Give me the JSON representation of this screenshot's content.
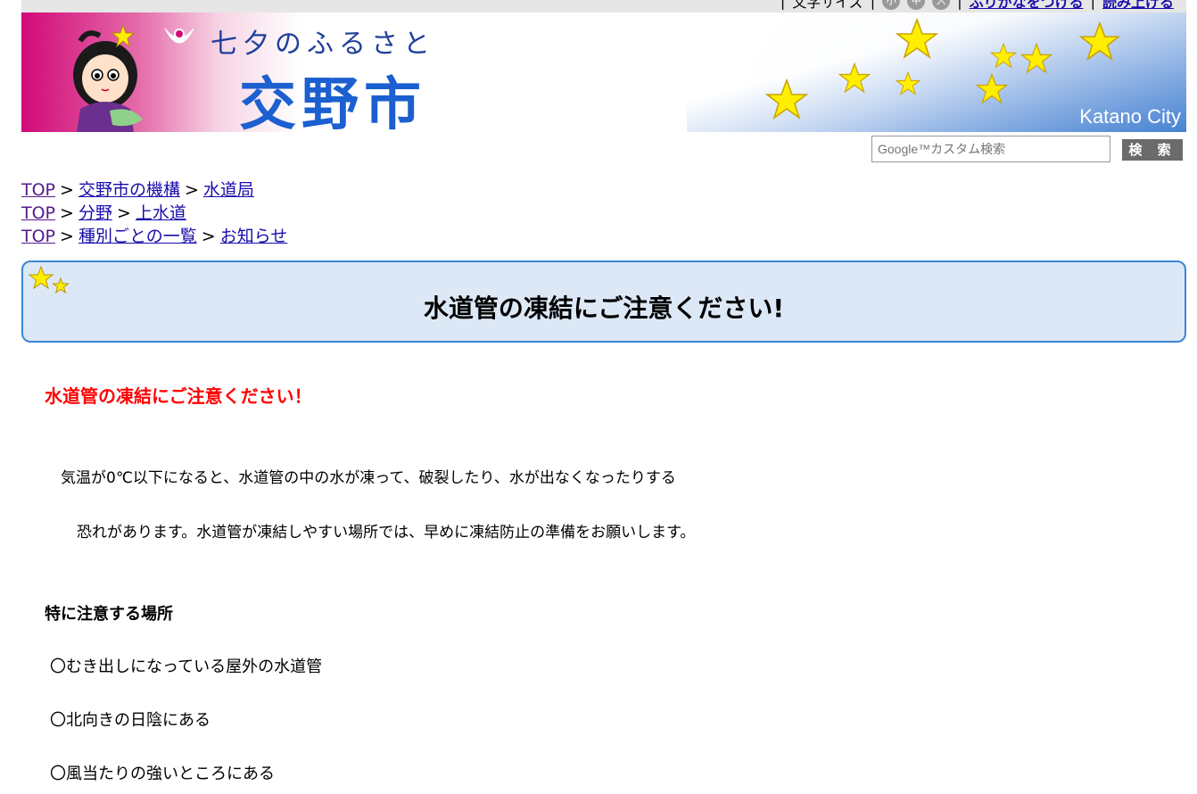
{
  "topbar": {
    "text_fragment": "文字サイズ",
    "sizes": [
      "小",
      "中",
      "大"
    ],
    "link1": "ふりがなをつける",
    "link2": "読み上げる"
  },
  "header": {
    "tagline": "七夕のふるさと",
    "city_name": "交野市",
    "city_name_en": "Katano City"
  },
  "search": {
    "placeholder": "Google™カスタム検索",
    "button_label": "検 索"
  },
  "breadcrumbs": [
    [
      "TOP",
      "交野市の機構",
      "水道局"
    ],
    [
      "TOP",
      "分野",
      "上水道"
    ],
    [
      "TOP",
      "種別ごとの一覧",
      "お知らせ"
    ]
  ],
  "breadcrumb_separator": ">",
  "page": {
    "title": "水道管の凍結にご注意ください!",
    "red_heading": "水道管の凍結にご注意ください！",
    "paragraph1": "気温が0℃以下になると、水道管の中の水が凍って、破裂したり、水が出なくなったりする",
    "paragraph2": "恐れがあります。水道管が凍結しやすい場所では、早めに凍結防止の準備をお願いします。",
    "sub_heading": "特に注意する場所",
    "items": [
      "〇むき出しになっている屋外の水道管",
      "〇北向きの日陰にある",
      "〇風当たりの強いところにある"
    ]
  },
  "colors": {
    "link": "#1a0dab",
    "visited_link": "#551a8b",
    "title_box_bg": "#dde8f6",
    "title_box_border": "#3b86d6",
    "alert_red": "#ff0000",
    "banner_pink": "#d10a78",
    "banner_blue": "#2f72cc",
    "star_yellow": "#ffee00"
  },
  "icons": {
    "emblem": "city-emblem-icon",
    "mascot": "orihime-mascot",
    "stars": "star-icon"
  }
}
